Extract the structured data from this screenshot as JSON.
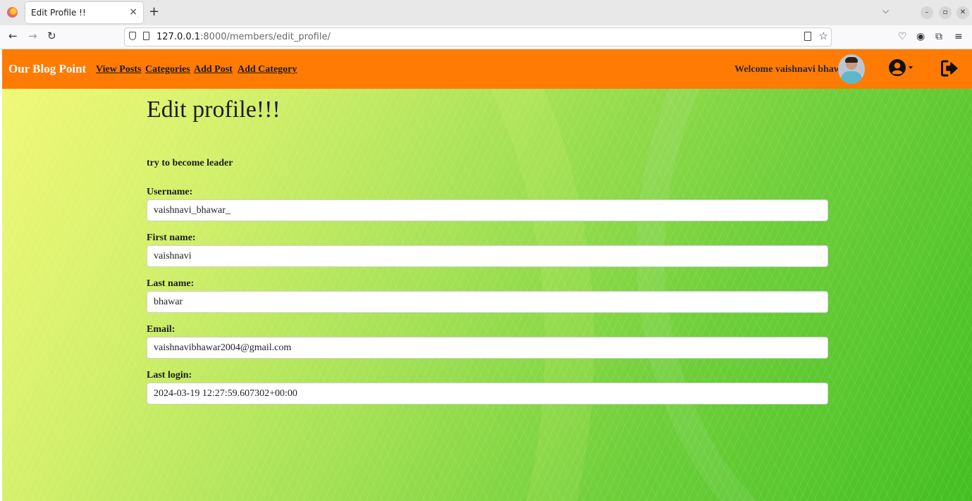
{
  "browser": {
    "tab_title": "Edit Profile !!",
    "tab_close": "×",
    "new_tab": "+",
    "url_host": "127.0.0.1",
    "url_rest": ":8000/members/edit_profile/"
  },
  "navbar": {
    "brand": "Our Blog Point",
    "links": [
      "View Posts",
      "Categories",
      "Add Post",
      "Add Category"
    ],
    "welcome": "Welcome vaishnavi bhawar",
    "bg_color": "#ff7b04"
  },
  "main": {
    "title": "Edit profile!!!",
    "subtitle": "try to become leader",
    "fields": [
      {
        "label": "Username:",
        "value": "vaishnavi_bhawar_"
      },
      {
        "label": "First name:",
        "value": "vaishnavi"
      },
      {
        "label": "Last name:",
        "value": "bhawar"
      },
      {
        "label": "Email:",
        "value": "vaishnavibhawar2004@gmail.com"
      },
      {
        "label": "Last login:",
        "value": "2024-03-19 12:27:59.607302+00:00"
      }
    ]
  }
}
